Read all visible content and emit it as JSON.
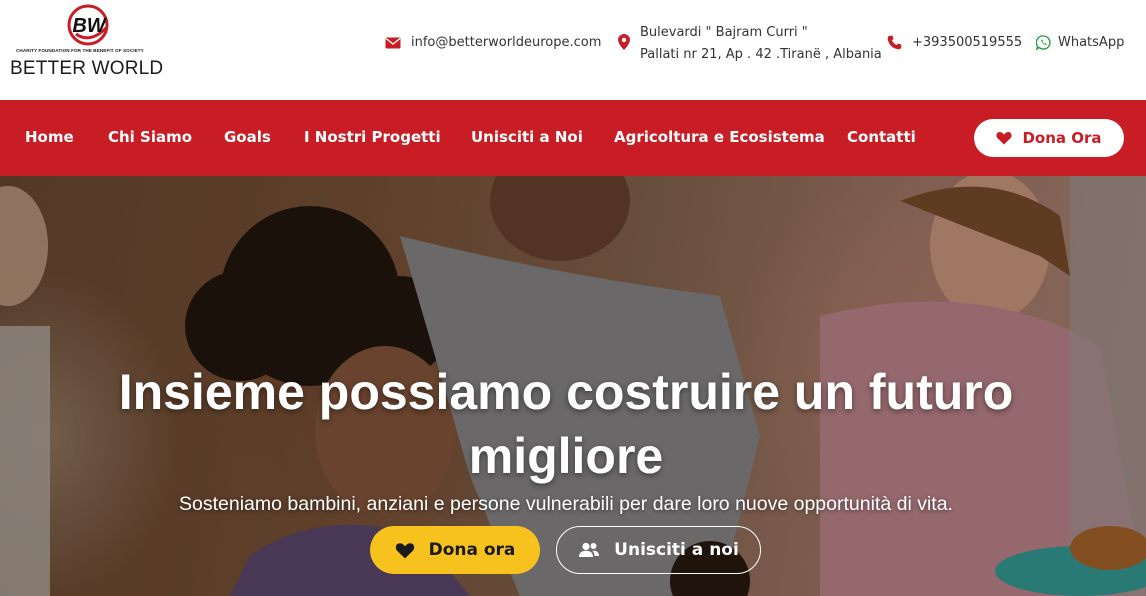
{
  "brand": {
    "mark_letters": "BW",
    "tagline": "CHARITY FOUNDATION FOR THE BENEFIT OF SOCIETY",
    "name": "BETTER WORLD"
  },
  "contacts": {
    "email": "info@betterworldeurope.com",
    "address_line1": "Bulevardi \" Bajram Curri \"",
    "address_line2": "Pallati nr 21, Ap . 42 .Tiranë , Albania",
    "phone": "+393500519555",
    "whatsapp": "WhatsApp"
  },
  "nav": {
    "items": [
      {
        "label": "Home"
      },
      {
        "label": "Chi Siamo"
      },
      {
        "label": "Goals"
      },
      {
        "label": "I Nostri Progetti"
      },
      {
        "label": "Unisciti a Noi"
      },
      {
        "label": "Agricoltura e Ecosistema"
      },
      {
        "label": "Contatti"
      }
    ],
    "donate_label": "Dona Ora"
  },
  "hero": {
    "title": "Insieme possiamo costruire un futuro migliore",
    "subtitle": "Sosteniamo bambini, anziani e persone vulnerabili per dare loro nuove opportunità di vita.",
    "donate_label": "Dona ora",
    "join_label": "Unisciti a noi"
  },
  "icons": {
    "email": "envelope-icon",
    "address": "map-pin-icon",
    "phone": "phone-icon",
    "whatsapp": "whatsapp-icon",
    "heart": "heart-icon",
    "users": "users-icon"
  },
  "colors": {
    "brand_red": "#c81d25",
    "donate_yellow": "#f7c21d",
    "white": "#ffffff"
  }
}
